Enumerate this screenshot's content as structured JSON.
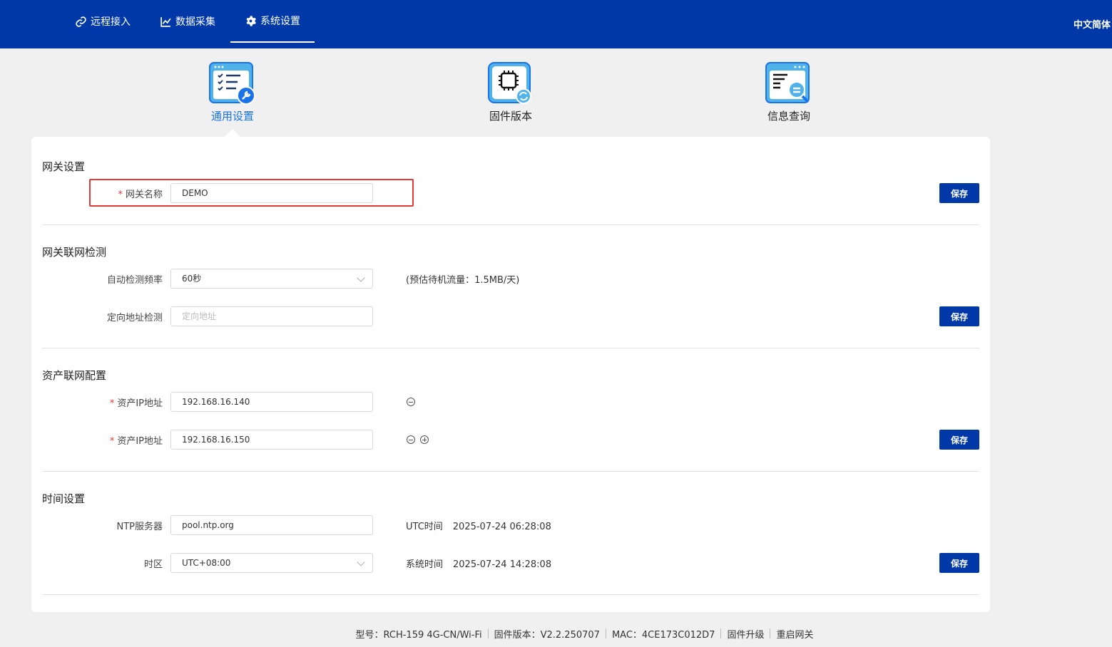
{
  "nav": {
    "items": [
      {
        "label": "远程接入",
        "icon": "link-icon"
      },
      {
        "label": "数据采集",
        "icon": "chart-icon"
      },
      {
        "label": "系统设置",
        "icon": "gear-icon"
      }
    ],
    "lang": "中文简体"
  },
  "categories": [
    {
      "label": "通用设置",
      "icon": "settings-window-icon"
    },
    {
      "label": "固件版本",
      "icon": "firmware-chip-icon"
    },
    {
      "label": "信息查询",
      "icon": "info-query-icon"
    }
  ],
  "gateway": {
    "title": "网关设置",
    "name_label": "网关名称",
    "name_value": "DEMO",
    "save": "保存"
  },
  "net_check": {
    "title": "网关联网检测",
    "freq_label": "自动检测频率",
    "freq_value": "60秒",
    "freq_note": "(预估待机流量：1.5MB/天)",
    "addr_label": "定向地址检测",
    "addr_placeholder": "定向地址",
    "save": "保存"
  },
  "asset": {
    "title": "资产联网配置",
    "rows": [
      {
        "label": "资产IP地址",
        "value": "192.168.16.140"
      },
      {
        "label": "资产IP地址",
        "value": "192.168.16.150"
      }
    ],
    "save": "保存"
  },
  "time": {
    "title": "时间设置",
    "ntp_label": "NTP服务器",
    "ntp_value": "pool.ntp.org",
    "utc_label": "UTC时间",
    "utc_value": "2025-07-24 06:28:08",
    "tz_label": "时区",
    "tz_value": "UTC+08:00",
    "sys_label": "系统时间",
    "sys_value": "2025-07-24 14:28:08",
    "save": "保存"
  },
  "footer": {
    "model": "型号：RCH-159  4G-CN/Wi-Fi",
    "firmware": "固件版本：V2.2.250707",
    "mac": "MAC：4CE173C012D7",
    "upgrade": "固件升级",
    "reboot": "重启网关"
  },
  "colors": {
    "brand": "#0038a8",
    "active_tab_text": "#1a73e8",
    "highlight": "#e53935"
  }
}
